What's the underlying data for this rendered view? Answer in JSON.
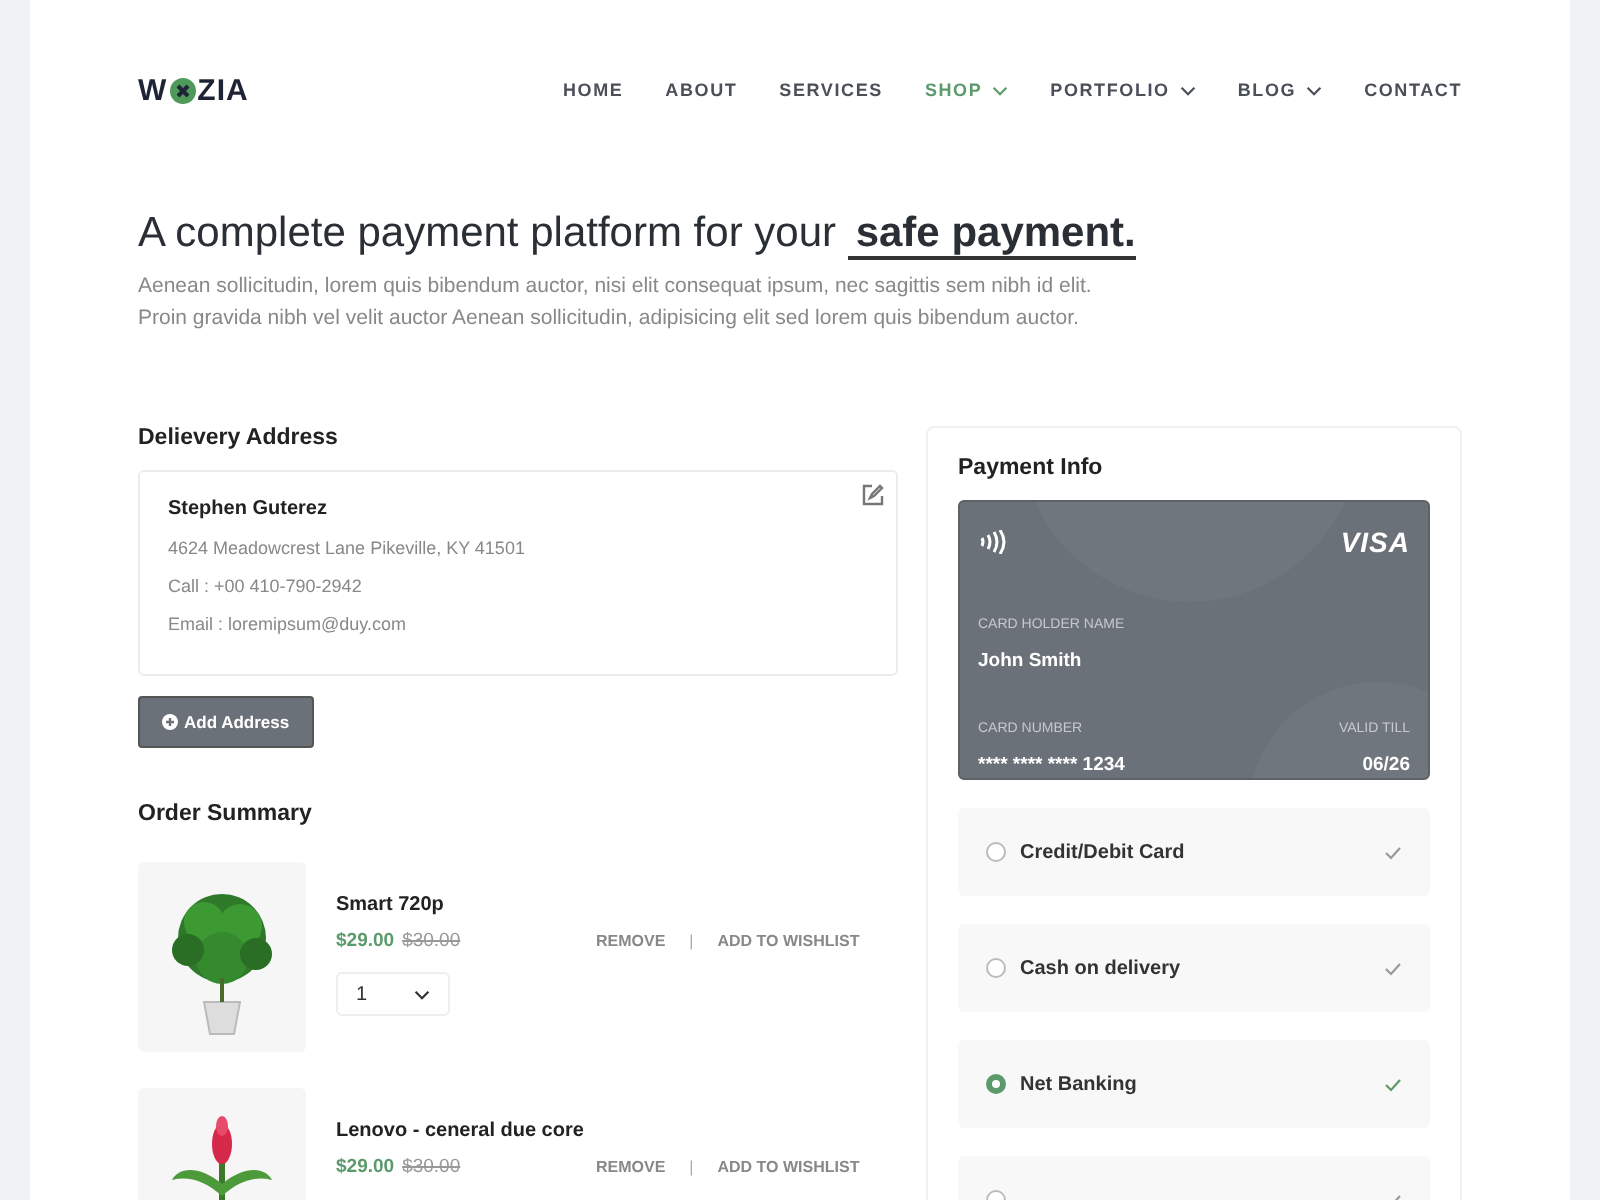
{
  "logo": {
    "left": "W",
    "right": "ZIA"
  },
  "nav": [
    {
      "label": "HOME",
      "selected": false,
      "dropdown": false
    },
    {
      "label": "ABOUT",
      "selected": false,
      "dropdown": false
    },
    {
      "label": "SERVICES",
      "selected": false,
      "dropdown": false
    },
    {
      "label": "SHOP",
      "selected": true,
      "dropdown": true
    },
    {
      "label": "PORTFOLIO",
      "selected": false,
      "dropdown": true
    },
    {
      "label": "BLOG",
      "selected": false,
      "dropdown": true
    },
    {
      "label": "CONTACT",
      "selected": false,
      "dropdown": false
    }
  ],
  "hero": {
    "title": "A complete payment platform for your **safe payment.**",
    "text": "Aenean sollicitudin, lorem quis bibendum auctor, nisi elit consequat ipsum, nec sagittis sem nibh id elit. Proin gravida nibh vel velit auctor Aenean sollicitudin, adipisicing elit sed lorem quis bibendum auctor."
  },
  "address": {
    "heading": "Delievery Address",
    "name": "Stephen Guterez",
    "lines": [
      "4624 Meadowcrest Lane Pikeville, KY 41501",
      "Call : +00 410-790-2942",
      "Email : loremipsum@duy.com"
    ],
    "button": "Add Address"
  },
  "order": {
    "heading": "Order Summary",
    "items": [
      {
        "name": "Smart 720p",
        "price": "$29.00",
        "old_price": "$30.00",
        "remove": "REMOVE",
        "separator": "|",
        "wishlist": "ADD TO WISHLIST",
        "quantity": "1",
        "kind": "leafy"
      },
      {
        "name": "Lenovo - ceneral due core",
        "price": "$29.00",
        "old_price": "$30.00",
        "remove": "REMOVE",
        "separator": "|",
        "wishlist": "ADD TO WISHLIST",
        "kind": "flower"
      }
    ]
  },
  "payment": {
    "heading": "Payment Info",
    "card": {
      "brand": "VISA",
      "holder_label": "CARD HOLDER NAME",
      "holder": "John Smith",
      "number_label": "CARD NUMBER",
      "number": "**** **** **** 1234",
      "valid_label": "VALID TILL",
      "valid": "06/26"
    },
    "options": [
      {
        "label": "Credit/Debit Card",
        "selected": false
      },
      {
        "label": "Cash on delivery",
        "selected": false
      },
      {
        "label": "Net Banking",
        "selected": true
      },
      {
        "selected": false
      }
    ]
  }
}
